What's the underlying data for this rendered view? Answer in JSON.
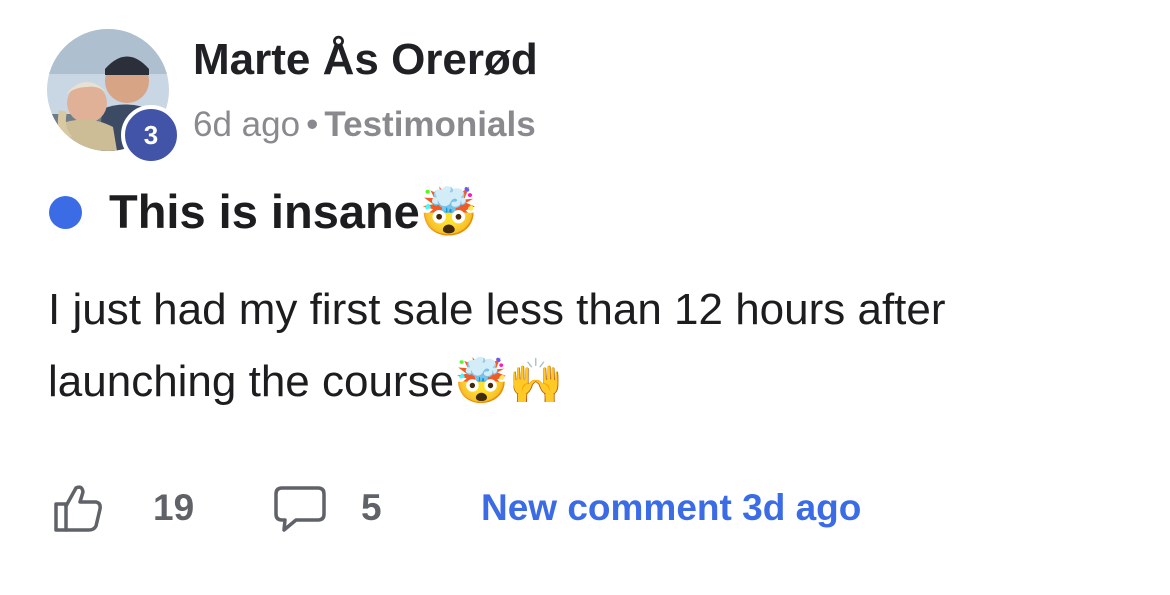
{
  "post": {
    "author": {
      "name": "Marte Ås Orerød",
      "level": "3",
      "avatar_icon": "profile-photo"
    },
    "meta": {
      "time_ago": "6d ago",
      "separator": "•",
      "category": "Testimonials"
    },
    "unread_dot_color": "#3b6ce6",
    "title": {
      "text": "This is insane",
      "emoji": "🤯"
    },
    "body": {
      "text": "I just had my first sale less than 12 hours after launching the course",
      "emoji": "🤯🙌"
    },
    "footer": {
      "like_icon": "thumbs-up-icon",
      "like_count": "19",
      "comment_icon": "comment-bubble-icon",
      "comment_count": "5",
      "new_comment_label": "New comment 3d ago",
      "link_color": "#3b6ce6"
    }
  }
}
